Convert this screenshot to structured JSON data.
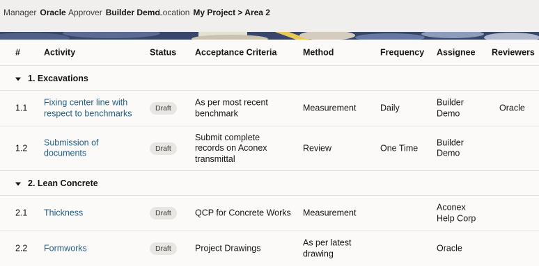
{
  "meta": {
    "manager_label": "Manager",
    "manager_value": "Oracle",
    "approver_label": "Approver",
    "approver_value": "Builder Demo",
    "location_label": "Location",
    "location_value": "My Project > Area 2"
  },
  "table": {
    "headers": {
      "num": "#",
      "activity": "Activity",
      "status": "Status",
      "criteria": "Acceptance Criteria",
      "method": "Method",
      "frequency": "Frequency",
      "assignee": "Assignee",
      "reviewers": "Reviewers"
    },
    "groups": [
      {
        "label": "1. Excavations",
        "rows": [
          {
            "num": "1.1",
            "activity": "Fixing center line with respect to benchmarks",
            "status": "Draft",
            "criteria": "As per most recent benchmark",
            "method": "Measurement",
            "frequency": "Daily",
            "assignee": "Builder Demo",
            "reviewers": "Oracle"
          },
          {
            "num": "1.2",
            "activity": "Submission of documents",
            "status": "Draft",
            "criteria": "Submit complete records on Aconex transmittal",
            "method": "Review",
            "frequency": "One Time",
            "assignee": "Builder Demo",
            "reviewers": ""
          }
        ]
      },
      {
        "label": "2. Lean Concrete",
        "rows": [
          {
            "num": "2.1",
            "activity": "Thickness",
            "status": "Draft",
            "criteria": "QCP for Concrete Works",
            "method": "Measurement",
            "frequency": "",
            "assignee": "Aconex Help Corp",
            "reviewers": ""
          },
          {
            "num": "2.2",
            "activity": "Formworks",
            "status": "Draft",
            "criteria": "Project Drawings",
            "method": "As per latest drawing",
            "frequency": "",
            "assignee": "Oracle",
            "reviewers": ""
          }
        ]
      }
    ]
  }
}
